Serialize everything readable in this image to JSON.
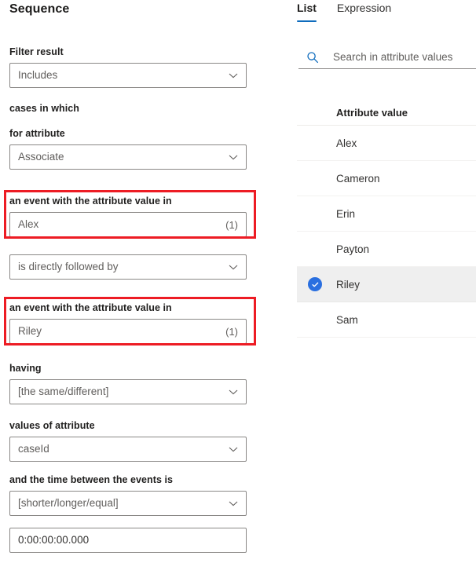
{
  "left": {
    "title": "Sequence",
    "fields": [
      {
        "label": "Filter result",
        "control": "dropdown",
        "value": "Includes",
        "placeholder_style": true
      },
      {
        "label": "cases in which",
        "control": "none"
      },
      {
        "label": "for attribute",
        "control": "dropdown",
        "value": "Associate",
        "placeholder_style": true
      },
      {
        "label": "an event with the attribute value in",
        "control": "picker",
        "value": "Alex",
        "count": "(1)",
        "highlighted": true
      },
      {
        "label": "",
        "control": "dropdown",
        "value": "is directly followed by",
        "placeholder_style": true
      },
      {
        "label": "an event with the attribute value in",
        "control": "picker",
        "value": "Riley",
        "count": "(1)",
        "highlighted": true
      },
      {
        "label": "having",
        "control": "dropdown",
        "value": "[the same/different]",
        "placeholder_style": true
      },
      {
        "label": "values of attribute",
        "control": "dropdown",
        "value": "caseId",
        "placeholder_style": true
      },
      {
        "label": "and the time between the events is",
        "control": "dropdown",
        "value": "[shorter/longer/equal]",
        "placeholder_style": true
      },
      {
        "label": "",
        "control": "text",
        "value": "0:00:00:00.000"
      }
    ]
  },
  "right": {
    "tabs": [
      {
        "label": "List",
        "active": true
      },
      {
        "label": "Expression",
        "active": false
      }
    ],
    "search": {
      "placeholder": "Search in attribute values",
      "value": "",
      "icon": "search-icon"
    },
    "list_header": "Attribute value",
    "items": [
      {
        "label": "Alex",
        "selected": false
      },
      {
        "label": "Cameron",
        "selected": false
      },
      {
        "label": "Erin",
        "selected": false
      },
      {
        "label": "Payton",
        "selected": false
      },
      {
        "label": "Riley",
        "selected": true
      },
      {
        "label": "Sam",
        "selected": false
      }
    ]
  },
  "colors": {
    "accent": "#0f6cbd",
    "selection": "#2a6fe0",
    "highlight_border": "#ed1c24",
    "row_selected_bg": "#efefef"
  }
}
